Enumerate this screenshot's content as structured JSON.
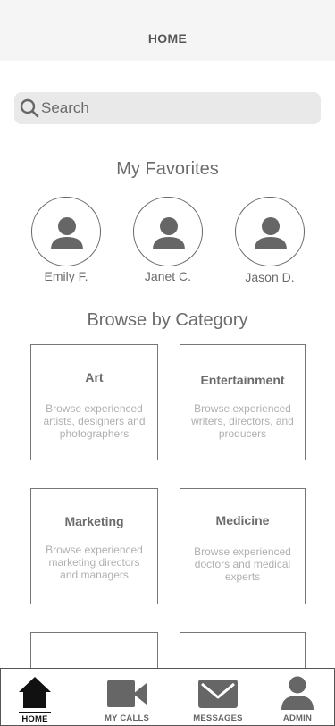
{
  "header": {
    "title": "HOME"
  },
  "search": {
    "placeholder": "Search"
  },
  "favorites": {
    "title": "My Favorites",
    "items": [
      {
        "name": "Emily F."
      },
      {
        "name": "Janet C."
      },
      {
        "name": "Jason D."
      }
    ]
  },
  "categories": {
    "title": "Browse by Category",
    "items": [
      {
        "title": "Art",
        "description": "Browse experienced artists, designers and photographers"
      },
      {
        "title": "Entertainment",
        "description": "Browse experienced writers, directors, and producers"
      },
      {
        "title": "Marketing",
        "description": "Browse experienced marketing directors and managers"
      },
      {
        "title": "Medicine",
        "description": "Browse experienced doctors and medical experts"
      }
    ]
  },
  "tabbar": {
    "items": [
      {
        "label": "HOME",
        "icon": "home-icon",
        "active": true
      },
      {
        "label": "MY CALLS",
        "icon": "video-camera-icon",
        "active": false
      },
      {
        "label": "MESSAGES",
        "icon": "envelope-icon",
        "active": false
      },
      {
        "label": "ADMIN",
        "icon": "user-icon",
        "active": false
      }
    ]
  },
  "colors": {
    "active_tab": "#111111",
    "inactive_icon": "#666666",
    "card_border": "#777777",
    "header_bg": "#f5f5f5"
  }
}
